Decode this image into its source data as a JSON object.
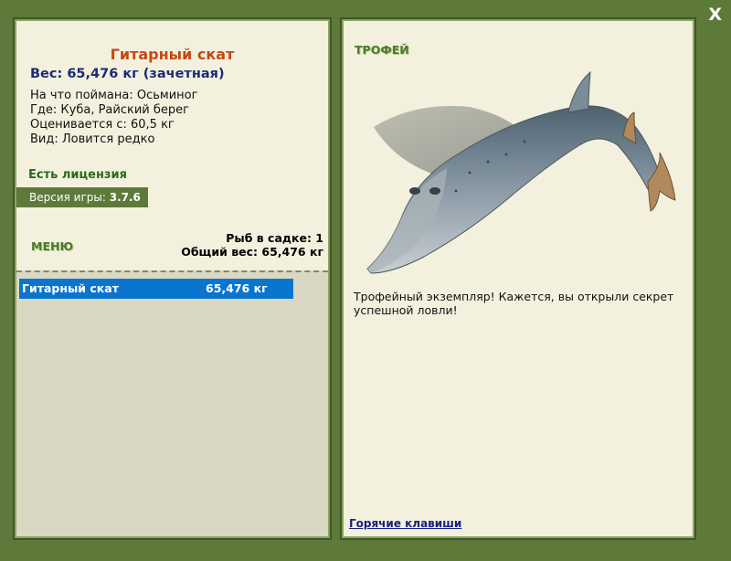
{
  "close_label": "X",
  "fish": {
    "title": "Гитарный скат",
    "weight_line": "Вес: 65,476 кг (зачетная)",
    "caught_on": "На что поймана: Осьминог",
    "location": "Где: Куба, Райский берег",
    "valued_from": "Оценивается с: 60,5 кг",
    "kind": "Вид: Ловится редко"
  },
  "license": "Есть лицензия",
  "version": {
    "label": "Версия игры:",
    "value": "3.7.6"
  },
  "menu_label": "МЕНЮ",
  "keepnet": {
    "count_line": "Рыб в садке: 1",
    "total_line": "Общий вес: 65,476 кг"
  },
  "catch_list": [
    {
      "name": "Гитарный скат",
      "weight": "65,476 кг"
    }
  ],
  "trophy": {
    "label": "ТРОФЕЙ",
    "text": "Трофейный экземпляр! Кажется, вы открыли секрет успешной ловли!"
  },
  "hotkeys_link": "Горячие клавиши",
  "colors": {
    "background": "#5e7a3a",
    "panel": "#f3f1de",
    "selection": "#0a75cf",
    "title": "#c24a12",
    "weight": "#1c2a78"
  }
}
